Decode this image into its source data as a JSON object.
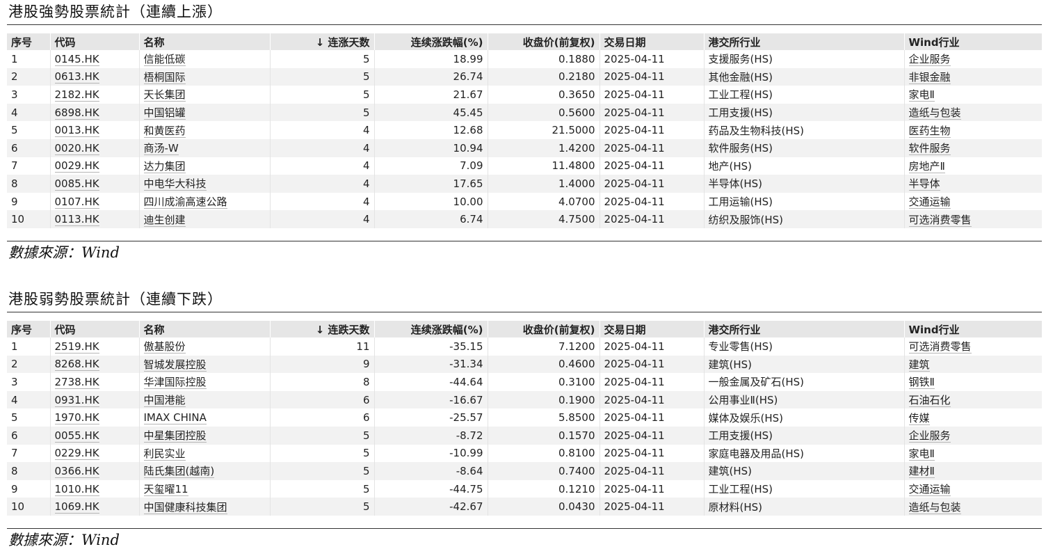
{
  "strong": {
    "title": "港股強勢股票統計（連續上漲）",
    "headers": [
      "序号",
      "代码",
      "名称",
      "↓ 连涨天数",
      "连续涨跌幅(%)",
      "收盘价(前复权)",
      "交易日期",
      "港交所行业",
      "Wind行业"
    ],
    "rows": [
      [
        "1",
        "0145.HK",
        "信能低碳",
        "5",
        "18.99",
        "0.1880",
        "2025-04-11",
        "支援服务(HS)",
        "企业服务"
      ],
      [
        "2",
        "0613.HK",
        "梧桐国际",
        "5",
        "26.74",
        "0.2180",
        "2025-04-11",
        "其他金融(HS)",
        "非银金融"
      ],
      [
        "3",
        "2182.HK",
        "天长集团",
        "5",
        "21.67",
        "0.3650",
        "2025-04-11",
        "工业工程(HS)",
        "家电Ⅱ"
      ],
      [
        "4",
        "6898.HK",
        "中国铝罐",
        "5",
        "45.45",
        "0.5600",
        "2025-04-11",
        "工用支援(HS)",
        "造纸与包装"
      ],
      [
        "5",
        "0013.HK",
        "和黄医药",
        "4",
        "12.68",
        "21.5000",
        "2025-04-11",
        "药品及生物科技(HS)",
        "医药生物"
      ],
      [
        "6",
        "0020.HK",
        "商汤-W",
        "4",
        "10.94",
        "1.4200",
        "2025-04-11",
        "软件服务(HS)",
        "软件服务"
      ],
      [
        "7",
        "0029.HK",
        "达力集团",
        "4",
        "7.09",
        "11.4800",
        "2025-04-11",
        "地产(HS)",
        "房地产Ⅱ"
      ],
      [
        "8",
        "0085.HK",
        "中电华大科技",
        "4",
        "17.65",
        "1.4000",
        "2025-04-11",
        "半导体(HS)",
        "半导体"
      ],
      [
        "9",
        "0107.HK",
        "四川成渝高速公路",
        "4",
        "10.00",
        "4.0700",
        "2025-04-11",
        "工用运输(HS)",
        "交通运输"
      ],
      [
        "10",
        "0113.HK",
        "迪生创建",
        "4",
        "6.74",
        "4.7500",
        "2025-04-11",
        "纺织及服饰(HS)",
        "可选消费零售"
      ]
    ],
    "source": "數據來源：Wind"
  },
  "weak": {
    "title": "港股弱勢股票統計（連續下跌）",
    "headers": [
      "序号",
      "代码",
      "名称",
      "↓ 连跌天数",
      "连续涨跌幅(%)",
      "收盘价(前复权)",
      "交易日期",
      "港交所行业",
      "Wind行业"
    ],
    "rows": [
      [
        "1",
        "2519.HK",
        "傲基股份",
        "11",
        "-35.15",
        "7.1200",
        "2025-04-11",
        "专业零售(HS)",
        "可选消费零售"
      ],
      [
        "2",
        "8268.HK",
        "智城发展控股",
        "9",
        "-31.34",
        "0.4600",
        "2025-04-11",
        "建筑(HS)",
        "建筑"
      ],
      [
        "3",
        "2738.HK",
        "华津国际控股",
        "8",
        "-44.64",
        "0.3100",
        "2025-04-11",
        "一般金属及矿石(HS)",
        "钢铁Ⅱ"
      ],
      [
        "4",
        "0931.HK",
        "中国港能",
        "6",
        "-16.67",
        "0.1900",
        "2025-04-11",
        "公用事业Ⅱ(HS)",
        "石油石化"
      ],
      [
        "5",
        "1970.HK",
        "IMAX CHINA",
        "6",
        "-25.57",
        "5.8500",
        "2025-04-11",
        "媒体及娱乐(HS)",
        "传媒"
      ],
      [
        "6",
        "0055.HK",
        "中星集团控股",
        "5",
        "-8.72",
        "0.1570",
        "2025-04-11",
        "工用支援(HS)",
        "企业服务"
      ],
      [
        "7",
        "0229.HK",
        "利民实业",
        "5",
        "-10.99",
        "0.8100",
        "2025-04-11",
        "家庭电器及用品(HS)",
        "家电Ⅱ"
      ],
      [
        "8",
        "0366.HK",
        "陆氏集团(越南)",
        "5",
        "-8.64",
        "0.7400",
        "2025-04-11",
        "建筑(HS)",
        "建材Ⅱ"
      ],
      [
        "9",
        "1010.HK",
        "天玺曜11",
        "5",
        "-44.75",
        "0.1210",
        "2025-04-11",
        "工业工程(HS)",
        "交通运输"
      ],
      [
        "10",
        "1069.HK",
        "中国健康科技集团",
        "5",
        "-42.67",
        "0.0430",
        "2025-04-11",
        "原材料(HS)",
        "造纸与包装"
      ]
    ],
    "source": "數據來源：Wind"
  }
}
